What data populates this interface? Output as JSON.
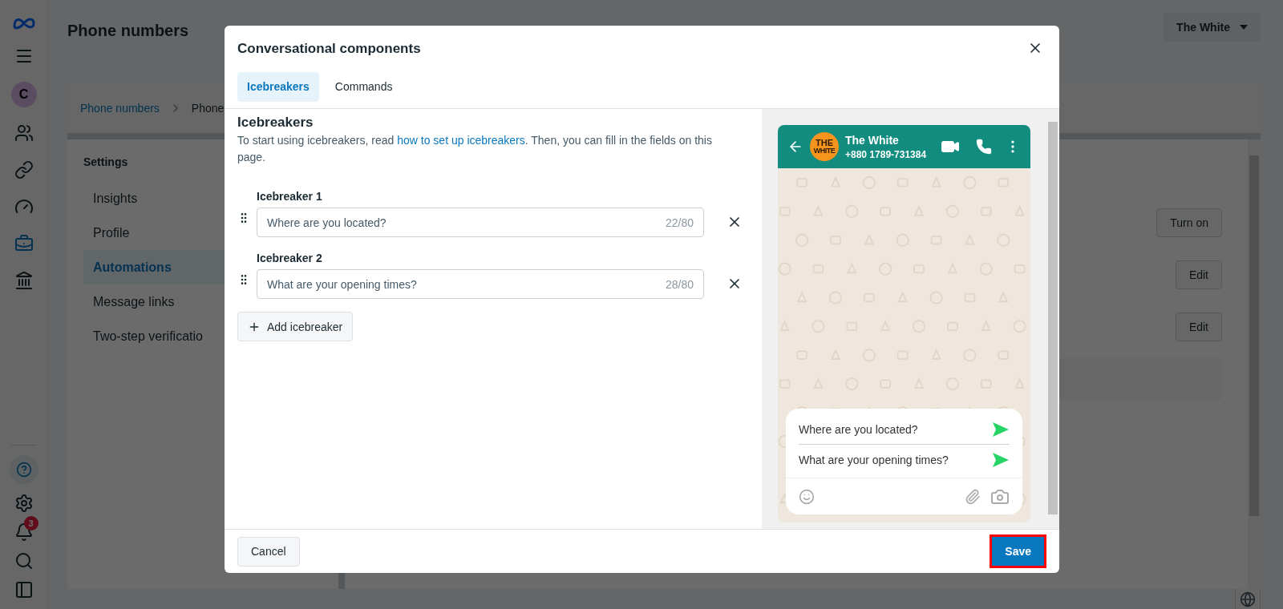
{
  "app_rail": {
    "avatar_letter": "C",
    "notification_count": "3",
    "top_items": [
      {
        "kind": "people",
        "selected": false
      },
      {
        "kind": "link",
        "selected": false
      },
      {
        "kind": "gauge",
        "selected": false
      },
      {
        "kind": "briefcase",
        "selected": true
      },
      {
        "kind": "bank",
        "selected": false
      }
    ],
    "bottom_items": [
      {
        "kind": "help"
      },
      {
        "kind": "settings"
      },
      {
        "kind": "bell"
      },
      {
        "kind": "search"
      },
      {
        "kind": "panel"
      }
    ]
  },
  "page": {
    "title": "Phone numbers",
    "account_button": "The White",
    "breadcrumb": [
      "Phone numbers",
      "Phone"
    ],
    "settings_heading": "Settings",
    "nav_items": [
      {
        "label": "Insights",
        "selected": false
      },
      {
        "label": "Profile",
        "selected": false
      },
      {
        "label": "Automations",
        "selected": true
      },
      {
        "label": "Message links",
        "selected": false
      },
      {
        "label": "Two-step verificatio",
        "selected": false
      }
    ],
    "actions": [
      "Turn on",
      "Edit",
      "Edit"
    ]
  },
  "dialog": {
    "title": "Conversational components",
    "tabs": [
      {
        "label": "Icebreakers",
        "selected": true
      },
      {
        "label": "Commands",
        "selected": false
      }
    ],
    "section_title": "Icebreakers",
    "description_start": "To start using icebreakers, read ",
    "description_link": "how to set up icebreakers",
    "description_end": ". Then, you can fill in the fields on this page.",
    "icebreakers": [
      {
        "label": "Icebreaker 1",
        "value": "Where are you located?",
        "count": "22/80"
      },
      {
        "label": "Icebreaker 2",
        "value": "What are your opening times?",
        "count": "28/80"
      }
    ],
    "add_button": "Add icebreaker",
    "preview": {
      "name": "The White",
      "phone": "+880 1789-731384",
      "avatar_logo": [
        "THE",
        "WHITE"
      ],
      "suggestions": [
        "Where are you located?",
        "What are your opening times?"
      ]
    },
    "cancel_button": "Cancel",
    "save_button": {
      "label": "Save",
      "highlighted": true
    }
  }
}
